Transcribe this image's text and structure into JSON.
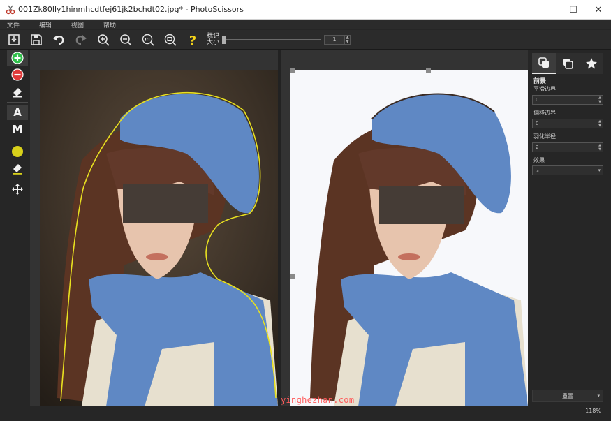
{
  "window": {
    "title": "001Zk80lly1hinmhcdtfej61jk2bchdt02.jpg* - PhotoScissors",
    "minimize": "—",
    "maximize": "☐",
    "close": "✕"
  },
  "menu": [
    "文件",
    "编辑",
    "视图",
    "帮助"
  ],
  "toolbar": {
    "icons": [
      "open-icon",
      "save-icon",
      "undo-icon",
      "redo-icon",
      "zoom-in-icon",
      "zoom-out-icon",
      "zoom-actual-icon",
      "zoom-fit-icon",
      "help-icon"
    ],
    "mark_size_label": "标记\n大小",
    "mark_size_value": "1",
    "mark_size_fraction": 0.0
  },
  "toolbox": {
    "icons": [
      "add-marker-icon",
      "remove-marker-icon",
      "eraser-icon",
      "auto-tool-letter",
      "manual-tool-letter",
      "color-marker-icon",
      "color-eraser-icon",
      "move-icon"
    ],
    "auto_letter": "A",
    "manual_letter": "M"
  },
  "panel": {
    "tabs": [
      "foreground-tab-icon",
      "background-tab-icon",
      "effects-tab-icon"
    ],
    "section_title": "前景",
    "fields": [
      {
        "label": "平滑边界",
        "value": "0",
        "kind": "spin"
      },
      {
        "label": "偏移边界",
        "value": "0",
        "kind": "spin"
      },
      {
        "label": "羽化半径",
        "value": "2",
        "kind": "spin"
      },
      {
        "label": "效果",
        "value": "无",
        "kind": "select"
      }
    ],
    "reset_label": "重置"
  },
  "status": {
    "zoom": "118%"
  },
  "watermark": "yinghezhan.com",
  "colors": {
    "accent_green": "#2fbf4a",
    "accent_red": "#e03a3a",
    "marker_yellow": "#e8e020",
    "help_yellow": "#f2d21a",
    "scarf_blue": "#5f88c4",
    "hair_brown": "#5b3423"
  }
}
